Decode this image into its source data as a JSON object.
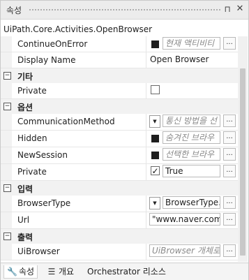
{
  "panel": {
    "title": "속성",
    "activity_name": "UiPath.Core.Activities.OpenBrowser"
  },
  "rows": {
    "continue_on_error": {
      "name": "ContinueOnError",
      "placeholder": "현재 액티비티"
    },
    "display_name": {
      "name": "Display Name",
      "value": "Open Browser"
    },
    "cat_misc": {
      "label": "기타"
    },
    "private_misc": {
      "name": "Private"
    },
    "cat_options": {
      "label": "옵션"
    },
    "communication_method": {
      "name": "CommunicationMethod",
      "placeholder": "통신 방법을 선"
    },
    "hidden": {
      "name": "Hidden",
      "placeholder": "숨겨진 브라우"
    },
    "new_session": {
      "name": "NewSession",
      "placeholder": "선택한 브라우"
    },
    "private_opt": {
      "name": "Private",
      "value": "True",
      "checked": true
    },
    "cat_input": {
      "label": "입력"
    },
    "browser_type": {
      "name": "BrowserType",
      "value": "BrowserType.C"
    },
    "url": {
      "name": "Url",
      "value": "\"www.naver.com\""
    },
    "cat_output": {
      "label": "출력"
    },
    "ui_browser": {
      "name": "UiBrowser",
      "placeholder": "UiBrowser 개체로"
    }
  },
  "common": {
    "ellipsis": "...",
    "collapse": "−",
    "check": "✓",
    "dropdown": "▼"
  },
  "tabs": [
    {
      "label": "속성",
      "icon": "wrench-icon"
    },
    {
      "label": "개요",
      "icon": "outline-icon"
    },
    {
      "label": "Orchestrator 리소스"
    }
  ],
  "title_icons": {
    "pin": "pin-icon",
    "close": "close-icon"
  }
}
